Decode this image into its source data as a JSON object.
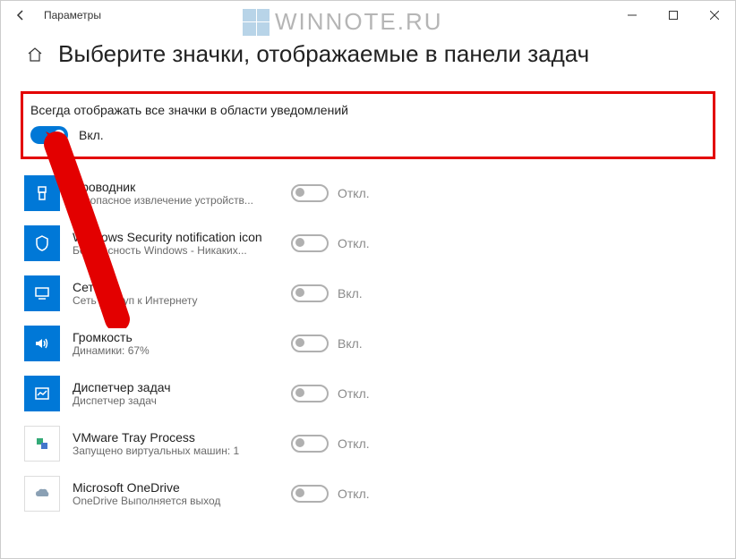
{
  "window": {
    "title": "Параметры"
  },
  "watermark": {
    "text1": "WINNOTE",
    "text2": ".RU"
  },
  "header": {
    "title": "Выберите значки, отображаемые в панели задач"
  },
  "master": {
    "label": "Всегда отображать все значки в области уведомлений",
    "state": "on",
    "state_label": "Вкл."
  },
  "labels": {
    "on": "Вкл.",
    "off": "Откл."
  },
  "items": [
    {
      "name": "Проводник",
      "desc": "Безопасное извлечение устройств...",
      "state": "off",
      "icon": "usb"
    },
    {
      "name": "Windows Security notification icon",
      "desc": "Безопасность Windows - Никаких...",
      "state": "off",
      "icon": "shield"
    },
    {
      "name": "Сеть",
      "desc": "Сеть Доступ к Интернету",
      "state": "on",
      "icon": "network"
    },
    {
      "name": "Громкость",
      "desc": "Динамики: 67%",
      "state": "on",
      "icon": "volume"
    },
    {
      "name": "Диспетчер задач",
      "desc": "Диспетчер задач",
      "state": "off",
      "icon": "taskmgr"
    },
    {
      "name": "VMware Tray Process",
      "desc": "Запущено виртуальных машин: 1",
      "state": "off",
      "icon": "vmware",
      "whiteBg": true
    },
    {
      "name": "Microsoft OneDrive",
      "desc": "OneDrive Выполняется выход",
      "state": "off",
      "icon": "onedrive",
      "whiteBg": true
    }
  ]
}
